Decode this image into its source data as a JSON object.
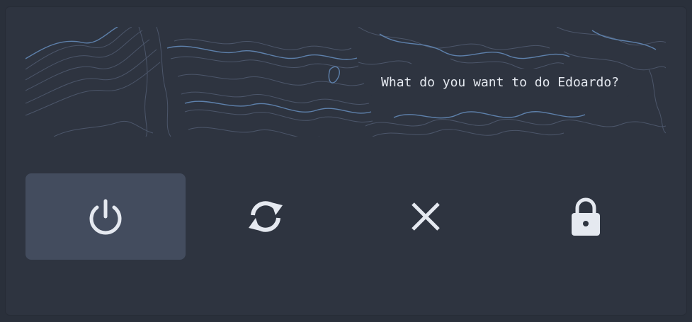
{
  "prompt": {
    "text": "What do you want to do Edoardo?"
  },
  "actions": [
    {
      "id": "shutdown",
      "icon": "power-icon",
      "selected": true
    },
    {
      "id": "reboot",
      "icon": "refresh-icon",
      "selected": false
    },
    {
      "id": "logout",
      "icon": "close-icon",
      "selected": false
    },
    {
      "id": "lock",
      "icon": "lock-icon",
      "selected": false
    }
  ],
  "colors": {
    "background": "#2e3440",
    "selected": "#434c5e",
    "icon": "#e5e9f0",
    "contour_light": "#4c566a",
    "contour_accent": "#5e81ac"
  }
}
